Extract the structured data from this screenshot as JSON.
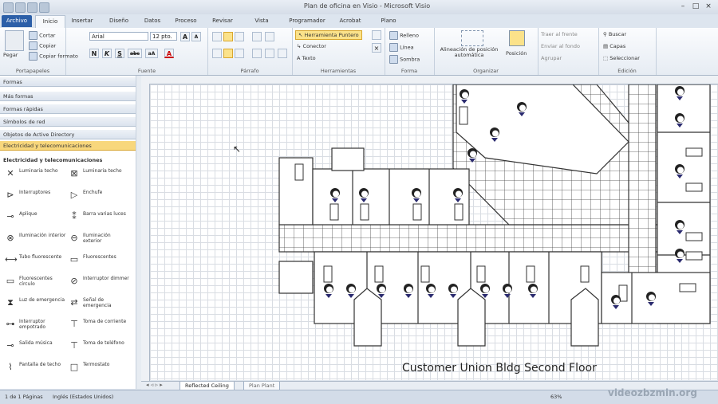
{
  "window": {
    "title": "Plan de oficina en Visio - Microsoft Visio",
    "minimize": "–",
    "maximize": "□",
    "close": "×"
  },
  "tabs": [
    "Archivo",
    "Inicio",
    "Insertar",
    "Diseño",
    "Datos",
    "Proceso",
    "Revisar",
    "Vista",
    "Programador",
    "Acrobat",
    "Plano"
  ],
  "ribbon": {
    "clipboard": {
      "label": "Portapapeles",
      "paste": "Pegar",
      "cut": "Cortar",
      "copy": "Copiar",
      "format_painter": "Copiar formato"
    },
    "font": {
      "label": "Fuente",
      "name": "Arial",
      "size": "12 pto.",
      "grow": "A",
      "shrink": "A",
      "bold": "N",
      "italic": "K",
      "underline": "S",
      "strike": "abc",
      "case": "aA",
      "color": "A"
    },
    "paragraph": {
      "label": "Párrafo"
    },
    "tools": {
      "label": "Herramientas",
      "pointer": "Herramienta Puntero",
      "connector": "Conector",
      "text": "Texto"
    },
    "shape": {
      "label": "Forma",
      "fill": "Relleno",
      "line": "Línea",
      "shadow": "Sombra"
    },
    "arrange": {
      "label": "Organizar",
      "align": "Alineación de posición automática",
      "position": "Posición"
    },
    "editing": {
      "label": "Edición",
      "find": "Buscar",
      "layers": "Capas",
      "select": "Seleccionar",
      "bring_front": "Traer al frente",
      "send_back": "Enviar al fondo",
      "group": "Agrupar"
    }
  },
  "shapes_panel": {
    "header": "Formas",
    "stencils": [
      "Más formas",
      "Formas rápidas",
      "Símbolos de red",
      "Objetos de Active Directory",
      "Electricidad y telecomunicaciones"
    ],
    "selected_stencil": "Electricidad y telecomunicaciones",
    "stencil_title": "Electricidad y telecomunicaciones",
    "shapes": [
      {
        "label": "Luminaria techo",
        "icon": "x-fixture-icon",
        "glyph": "✕"
      },
      {
        "label": "Luminaria techo",
        "icon": "x-box-fixture-icon",
        "glyph": "⊠"
      },
      {
        "label": "Interruptores",
        "icon": "switch-icon",
        "glyph": "⊳"
      },
      {
        "label": "Enchufe",
        "icon": "outlet-icon",
        "glyph": "▷"
      },
      {
        "label": "Aplique",
        "icon": "wall-light-icon",
        "glyph": "⊸"
      },
      {
        "label": "Barra varias luces",
        "icon": "multi-light-icon",
        "glyph": "⁑"
      },
      {
        "label": "Iluminación interior",
        "icon": "interior-light-icon",
        "glyph": "⊗"
      },
      {
        "label": "Iluminación exterior",
        "icon": "exterior-light-icon",
        "glyph": "⊖"
      },
      {
        "label": "Tubo fluorescente",
        "icon": "tube-icon",
        "glyph": "⟷"
      },
      {
        "label": "Fluorescentes",
        "icon": "fluorescent-icon",
        "glyph": "▭"
      },
      {
        "label": "Fluorescentes círculo",
        "icon": "circle-fluorescent-icon",
        "glyph": "▭"
      },
      {
        "label": "Interruptor dimmer",
        "icon": "dimmer-icon",
        "glyph": "⊘"
      },
      {
        "label": "Luz de emergencia",
        "icon": "emergency-light-icon",
        "glyph": "⧗"
      },
      {
        "label": "Señal de emergencia",
        "icon": "emergency-sign-icon",
        "glyph": "⇄"
      },
      {
        "label": "Interruptor empotrado",
        "icon": "recessed-switch-icon",
        "glyph": "⊶"
      },
      {
        "label": "Toma de corriente",
        "icon": "power-outlet-icon",
        "glyph": "⊤"
      },
      {
        "label": "Salida música",
        "icon": "music-out-icon",
        "glyph": "⊸"
      },
      {
        "label": "Toma de teléfono",
        "icon": "phone-jack-icon",
        "glyph": "⊤"
      },
      {
        "label": "Pantalla de techo",
        "icon": "ceiling-display-icon",
        "glyph": "⌇"
      },
      {
        "label": "Termostato",
        "icon": "thermostat-icon",
        "glyph": "□"
      }
    ]
  },
  "drawing": {
    "caption": "Customer Union Bldg Second Floor"
  },
  "sheet_tabs": [
    "Reflected Ceiling",
    "Plan Plant"
  ],
  "status": {
    "page": "1 de 1 Páginas",
    "language": "Inglés (Estados Unidos)",
    "zoom": "63%"
  },
  "watermark": "videozbzmin.org",
  "colors": {
    "file_tab": "#2c5fa8",
    "selected_stencil": "#f8d77c",
    "highlight": "#fbe28a"
  }
}
